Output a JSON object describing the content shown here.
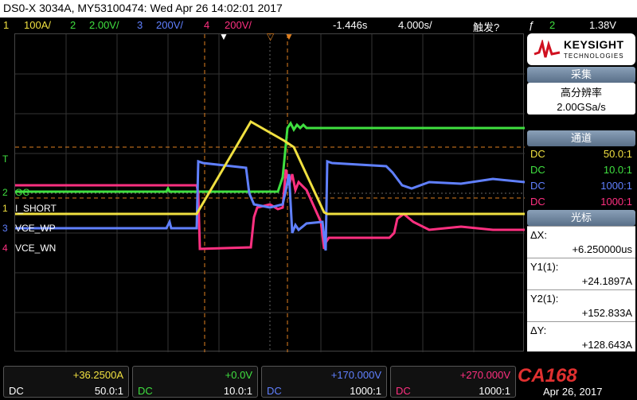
{
  "title": "DS0-X 3034A, MY53100474: Wed Apr 26 14:02:01 2017",
  "channels": [
    {
      "num": "1",
      "scale": "100A/",
      "color": "#f0e040"
    },
    {
      "num": "2",
      "scale": "2.00V/",
      "color": "#40e040"
    },
    {
      "num": "3",
      "scale": "200V/",
      "color": "#6080ff"
    },
    {
      "num": "4",
      "scale": "200V/",
      "color": "#ff3080"
    }
  ],
  "timebar": {
    "delay": "-1.446s",
    "timebase": "4.000s/",
    "trigger_label": "触发?",
    "trigger_ch": "2",
    "trigger_level": "1.38V"
  },
  "trace_labels": {
    "ch2": "OC",
    "ch1": "I_SHORT",
    "ch3": "VCE_WP",
    "ch4": "VCE_WN",
    "t": "T"
  },
  "trace_numbers": {
    "ch2": "2",
    "ch1": "1",
    "ch3": "3",
    "ch4": "4"
  },
  "logo": {
    "name": "KEYSIGHT",
    "sub": "TECHNOLOGIES"
  },
  "acquire": {
    "header": "采集",
    "mode": "高分辨率",
    "rate": "2.00GSa/s"
  },
  "channel_panel": {
    "header": "通道",
    "rows": [
      {
        "coupling": "DC",
        "probe": "50.0:1",
        "color": "#f0e040"
      },
      {
        "coupling": "DC",
        "probe": "10.0:1",
        "color": "#40e040"
      },
      {
        "coupling": "DC",
        "probe": "1000:1",
        "color": "#6080ff"
      },
      {
        "coupling": "DC",
        "probe": "1000:1",
        "color": "#ff3080"
      }
    ]
  },
  "cursors": {
    "header": "光标",
    "items": [
      {
        "label": "ΔX:",
        "value": "+6.250000us"
      },
      {
        "label": "Y1(1):",
        "value": "+24.1897A"
      },
      {
        "label": "Y2(1):",
        "value": "+152.833A"
      },
      {
        "label": "ΔY:",
        "value": "+128.643A"
      }
    ]
  },
  "measurements": [
    {
      "value": "+36.2500A",
      "coupling": "DC",
      "probe": "50.0:1",
      "color": "#f0e040"
    },
    {
      "value": "+0.0V",
      "coupling": "DC",
      "probe": "10.0:1",
      "color": "#40e040"
    },
    {
      "value": "+170.000V",
      "coupling": "DC",
      "probe": "1000:1",
      "color": "#6080ff"
    },
    {
      "value": "+270.000V",
      "coupling": "DC",
      "probe": "1000:1",
      "color": "#ff3080"
    }
  ],
  "watermark": {
    "brand": "CA168",
    "date": "Apr 26, 2017"
  }
}
